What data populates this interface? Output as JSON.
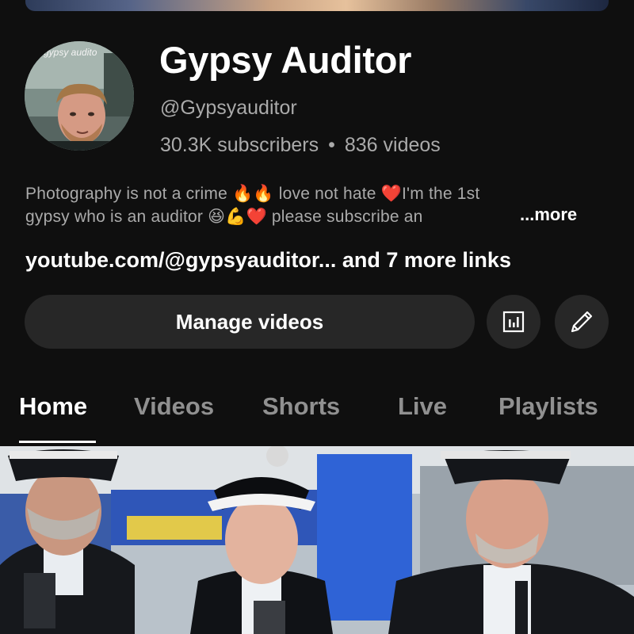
{
  "channel": {
    "name": "Gypsy Auditor",
    "handle": "@Gypsyauditor",
    "subscribers": "30.3K subscribers",
    "separator": "•",
    "videos": "836 videos",
    "avatar_caption": "gypsy audito",
    "description_line1": "Photography is not a crime 🔥🔥 love not hate ❤️I'm the 1st",
    "description_line2": "gypsy who is an auditor 😆💪❤️ please subscribe an",
    "more_label": "...more",
    "links_text": "youtube.com/@gypsyauditor... and 7 more links"
  },
  "actions": {
    "manage_label": "Manage videos",
    "analytics_icon": "bar-chart-icon",
    "edit_icon": "pencil-icon"
  },
  "tabs": [
    {
      "label": "Home",
      "active": true
    },
    {
      "label": "Videos",
      "active": false
    },
    {
      "label": "Shorts",
      "active": false
    },
    {
      "label": "Live",
      "active": false
    },
    {
      "label": "Playlists",
      "active": false
    }
  ],
  "colors": {
    "background": "#0f0f0f",
    "button": "#272727",
    "primary_text": "#ffffff",
    "secondary_text": "#aaaaaa",
    "inactive_tab": "#909090"
  }
}
